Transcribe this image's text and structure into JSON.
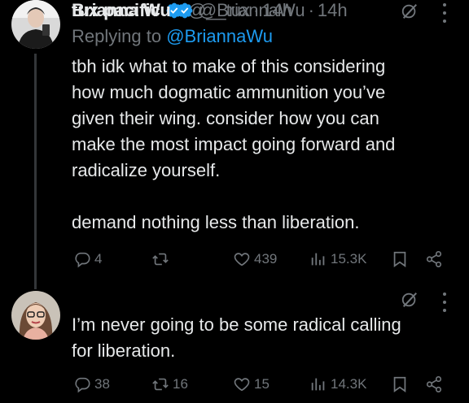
{
  "tweets": [
    {
      "name": "tux pacific",
      "handle": "@__tux",
      "dot": "·",
      "time": "14h",
      "replying_prefix": "Replying to ",
      "replying_to": "@BriannaWu",
      "paragraphs": [
        "tbh idk what to make of this considering\nhow much dogmatic ammunition you’ve\ngiven their wing. consider how you can\nmake the most impact going forward and\nradicalize yourself.",
        "demand nothing less than liberation."
      ],
      "replies": "4",
      "retweets": "",
      "likes": "439",
      "views": "15.3K"
    },
    {
      "name": "Brianna Wu",
      "handle": "@BriannaWu",
      "dot": "·",
      "time": "14h",
      "paragraphs": [
        "I’m never going to be some radical calling\nfor liberation."
      ],
      "replies": "38",
      "retweets": "16",
      "likes": "15",
      "views": "14.3K"
    }
  ],
  "icons": {
    "verified": "verified-badge-icon",
    "grok": "grok-icon",
    "more": "more-icon",
    "reply": "reply-icon",
    "retweet": "retweet-icon",
    "like": "heart-icon",
    "views": "views-icon",
    "bookmark": "bookmark-icon",
    "share": "share-icon"
  },
  "colors": {
    "background": "#000000",
    "text": "#e7e9ea",
    "muted": "#71767b",
    "accent": "#1d9bf0"
  }
}
